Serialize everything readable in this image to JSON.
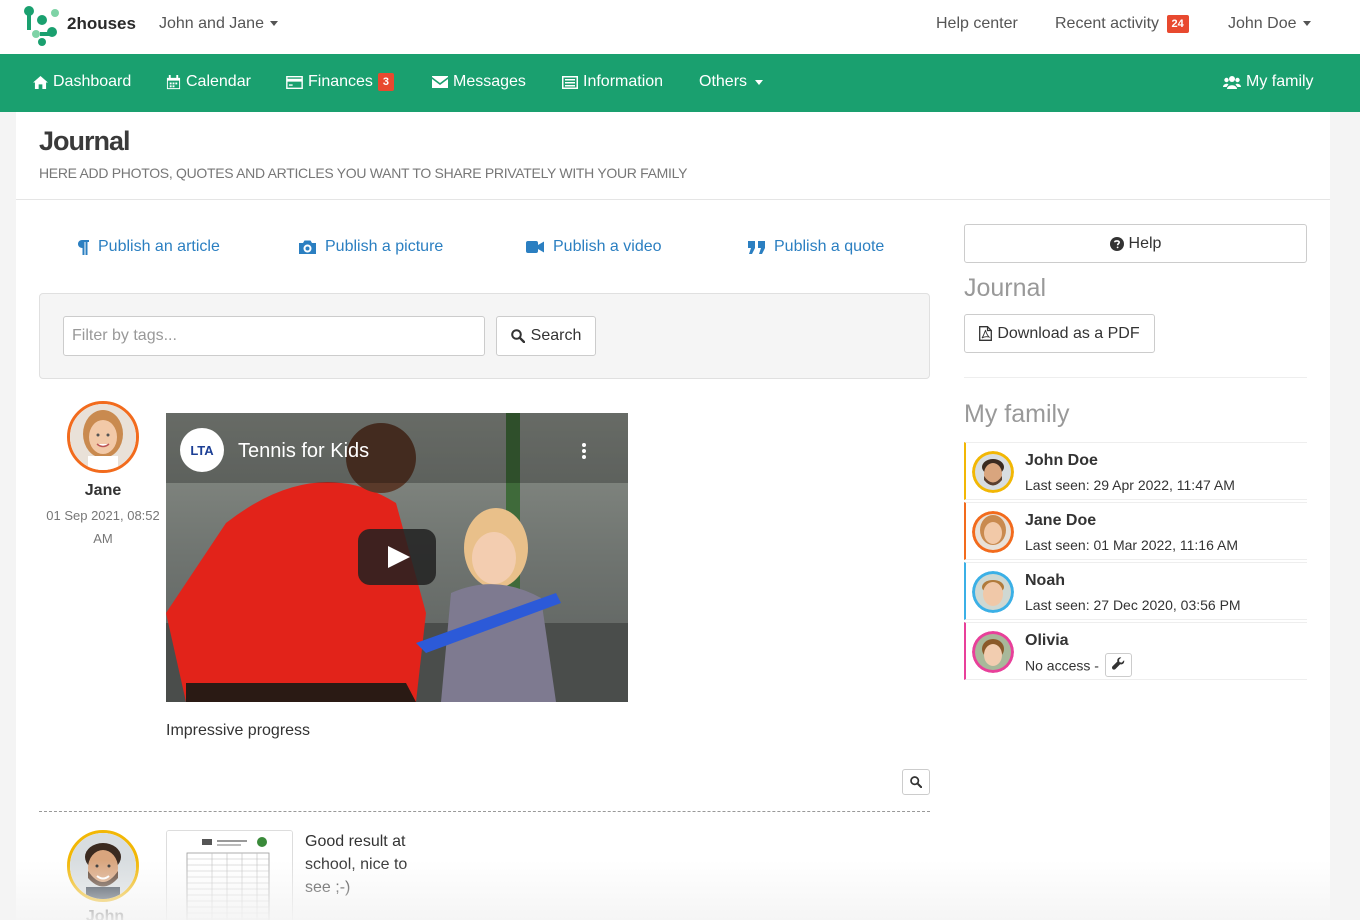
{
  "topbar": {
    "brand": "2houses",
    "family_switch": "John and Jane",
    "help_center": "Help center",
    "recent_activity": "Recent activity",
    "recent_activity_count": "24",
    "user_menu": "John Doe"
  },
  "nav": {
    "dashboard": "Dashboard",
    "calendar": "Calendar",
    "finances": "Finances",
    "finances_count": "3",
    "messages": "Messages",
    "information": "Information",
    "others": "Others",
    "my_family": "My family"
  },
  "page": {
    "title": "Journal",
    "subtitle": "HERE ADD PHOTOS, QUOTES AND ARTICLES YOU WANT TO SHARE PRIVATELY WITH YOUR FAMILY"
  },
  "actions": {
    "article": "Publish an article",
    "picture": "Publish a picture",
    "video": "Publish a video",
    "quote": "Publish a quote"
  },
  "filter": {
    "placeholder": "Filter by tags...",
    "search_label": "Search"
  },
  "posts": [
    {
      "author": "Jane",
      "date": "01 Sep 2021, 08:52 AM",
      "video_title": "Tennis for Kids",
      "video_channel": "LTA",
      "text": "Impressive progress"
    },
    {
      "author": "John",
      "text": "Good result at school, nice to see ;-)"
    }
  ],
  "sidebar": {
    "help_label": "Help",
    "journal_heading": "Journal",
    "pdf_label": "Download as a PDF",
    "family_heading": "My family",
    "members": [
      {
        "name": "John Doe",
        "status": "Last seen: 29 Apr 2022, 11:47 AM",
        "color": "#f2b705"
      },
      {
        "name": "Jane Doe",
        "status": "Last seen: 01 Mar 2022, 11:16 AM",
        "color": "#f26b1d"
      },
      {
        "name": "Noah",
        "status": "Last seen: 27 Dec 2020, 03:56 PM",
        "color": "#3bb0e6"
      },
      {
        "name": "Olivia",
        "status": "No access -",
        "color": "#e8409a"
      }
    ]
  },
  "colors": {
    "brand_green": "#1aa06f",
    "link_blue": "#2b7fc1",
    "badge_red": "#e8492f"
  }
}
